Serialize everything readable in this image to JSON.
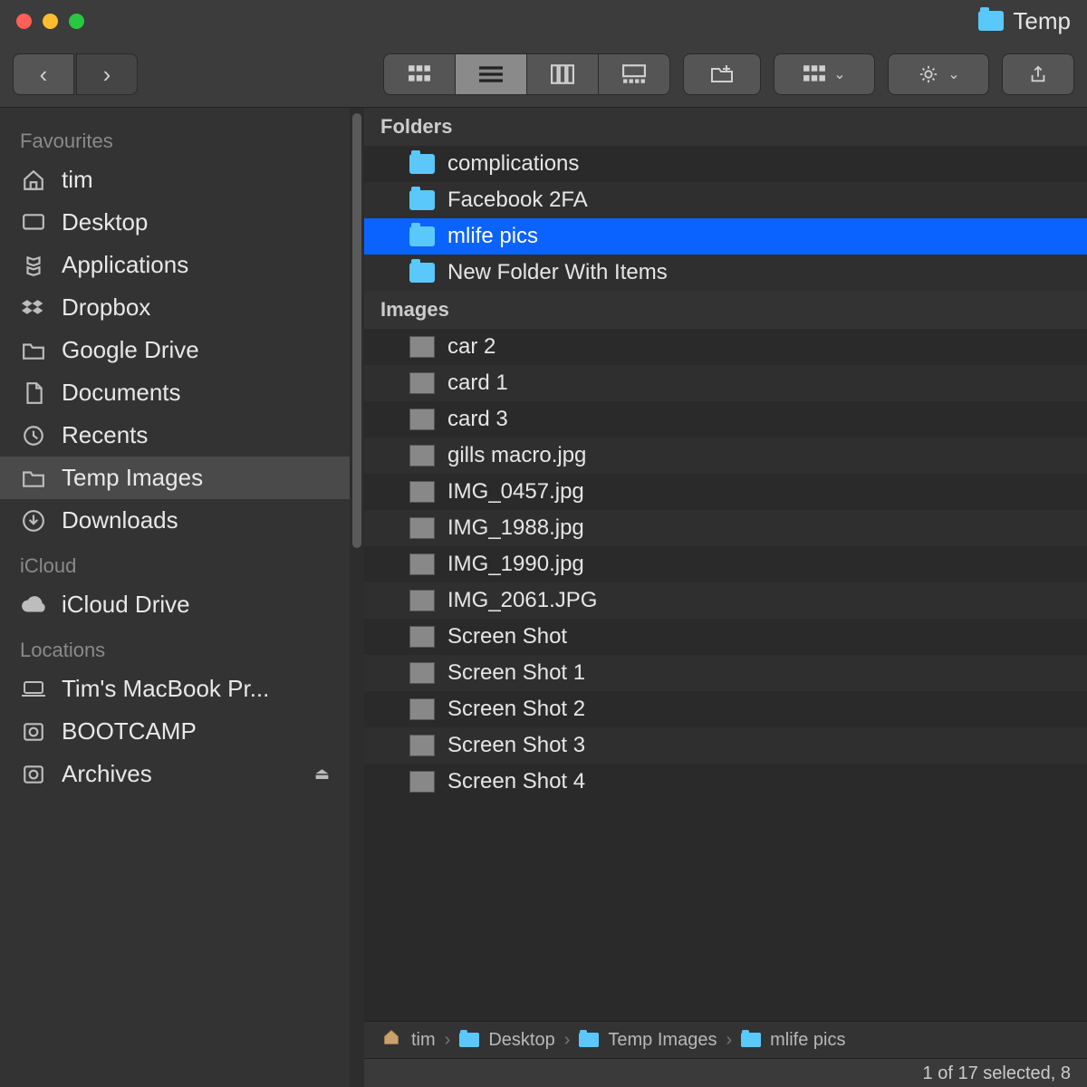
{
  "titlebar": {
    "window_title": "Temp"
  },
  "toolbar": {},
  "sidebar": {
    "sections": [
      {
        "label": "Favourites",
        "items": [
          {
            "icon": "home",
            "label": "tim"
          },
          {
            "icon": "desktop",
            "label": "Desktop"
          },
          {
            "icon": "apps",
            "label": "Applications"
          },
          {
            "icon": "dropbox",
            "label": "Dropbox"
          },
          {
            "icon": "folder",
            "label": "Google Drive"
          },
          {
            "icon": "doc",
            "label": "Documents"
          },
          {
            "icon": "recents",
            "label": "Recents"
          },
          {
            "icon": "folder",
            "label": "Temp Images",
            "selected": true
          },
          {
            "icon": "download",
            "label": "Downloads"
          }
        ]
      },
      {
        "label": "iCloud",
        "items": [
          {
            "icon": "cloud",
            "label": "iCloud Drive"
          }
        ]
      },
      {
        "label": "Locations",
        "items": [
          {
            "icon": "laptop",
            "label": "Tim's MacBook Pr..."
          },
          {
            "icon": "disk",
            "label": "BOOTCAMP"
          },
          {
            "icon": "disk",
            "label": "Archives",
            "eject": true
          }
        ]
      }
    ]
  },
  "content": {
    "groups": [
      {
        "label": "Folders",
        "type": "folder",
        "items": [
          {
            "name": "complications"
          },
          {
            "name": "Facebook 2FA"
          },
          {
            "name": "mlife pics",
            "selected": true
          },
          {
            "name": "New Folder With Items"
          }
        ]
      },
      {
        "label": "Images",
        "type": "image",
        "items": [
          {
            "name": "car 2"
          },
          {
            "name": "card 1"
          },
          {
            "name": "card 3"
          },
          {
            "name": "gills macro.jpg"
          },
          {
            "name": "IMG_0457.jpg"
          },
          {
            "name": "IMG_1988.jpg"
          },
          {
            "name": "IMG_1990.jpg"
          },
          {
            "name": "IMG_2061.JPG"
          },
          {
            "name": "Screen Shot"
          },
          {
            "name": "Screen Shot 1"
          },
          {
            "name": "Screen Shot 2"
          },
          {
            "name": "Screen Shot 3"
          },
          {
            "name": "Screen Shot 4"
          }
        ]
      }
    ]
  },
  "pathbar": {
    "items": [
      {
        "icon": "home",
        "label": "tim"
      },
      {
        "icon": "folder",
        "label": "Desktop"
      },
      {
        "icon": "folder",
        "label": "Temp Images"
      },
      {
        "icon": "folder",
        "label": "mlife pics"
      }
    ]
  },
  "statusbar": {
    "text": "1 of 17 selected, 8"
  }
}
